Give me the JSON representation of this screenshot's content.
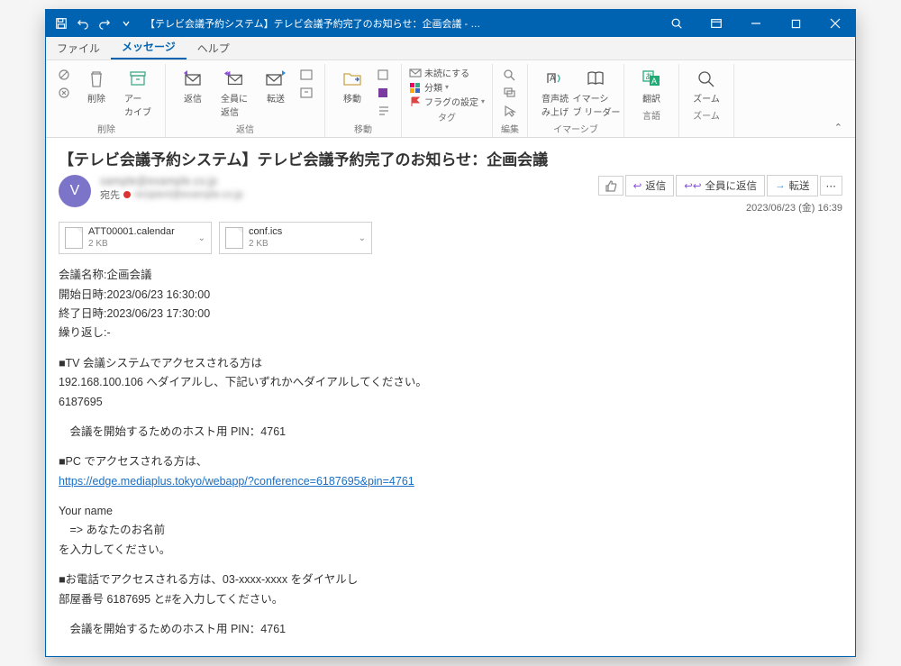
{
  "titlebar": {
    "title": "【テレビ会議予約システム】テレビ会議予約完了のお知らせ：企画会議 - …"
  },
  "tabs": {
    "file": "ファイル",
    "message": "メッセージ",
    "help": "ヘルプ"
  },
  "ribbon": {
    "delete_label": "削除",
    "archive": "アー\nカイブ",
    "reply_label": "返信",
    "reply": "返信",
    "reply_all": "全員に\n返信",
    "forward": "転送",
    "move_label": "移動",
    "move": "移動",
    "tags_label": "タグ",
    "unread": "未読にする",
    "category": "分類",
    "flag": "フラグの設定",
    "edit_label": "編集",
    "immersive_label": "イマーシブ",
    "read_aloud": "音声読\nみ上げ",
    "immersive_reader": "イマーシ\nブ リーダー",
    "language_label": "言語",
    "translate": "翻訳",
    "zoom_label": "ズーム",
    "zoom": "ズーム"
  },
  "mail": {
    "subject": "【テレビ会議予約システム】テレビ会議予約完了のお知らせ：企画会議",
    "from_blur": "sample@example.co.jp",
    "to_label": "宛先",
    "to_blur": "recipient@example.co.jp",
    "avatar_initial": "V",
    "datetime": "2023/06/23 (金) 16:39"
  },
  "actions": {
    "reply": "返信",
    "reply_all": "全員に返信",
    "forward": "転送"
  },
  "attachments": [
    {
      "name": "ATT00001.calendar",
      "size": "2 KB"
    },
    {
      "name": "conf.ics",
      "size": "2 KB"
    }
  ],
  "body": {
    "l1": "会議名称:企画会議",
    "l2": "開始日時:2023/06/23 16:30:00",
    "l3": "終了日時:2023/06/23 17:30:00",
    "l4": "繰り返し:-",
    "l5": "■TV 会議システムでアクセスされる方は",
    "l6": "192.168.100.106 へダイアルし、下記いずれかへダイアルしてください。",
    "l7": "6187695",
    "l8": "　会議を開始するためのホスト用 PIN：4761",
    "l9": "■PC でアクセスされる方は、",
    "link": "https://edge.mediaplus.tokyo/webapp/?conference=6187695&pin=4761",
    "l10": "Your name",
    "l11": "　=> あなたのお名前",
    "l12": "を入力してください。",
    "l13": "■お電話でアクセスされる方は、03-xxxx-xxxx をダイヤルし",
    "l14": "部屋番号 6187695 と#を入力してください。",
    "l15": "　会議を開始するためのホスト用 PIN：4761"
  }
}
